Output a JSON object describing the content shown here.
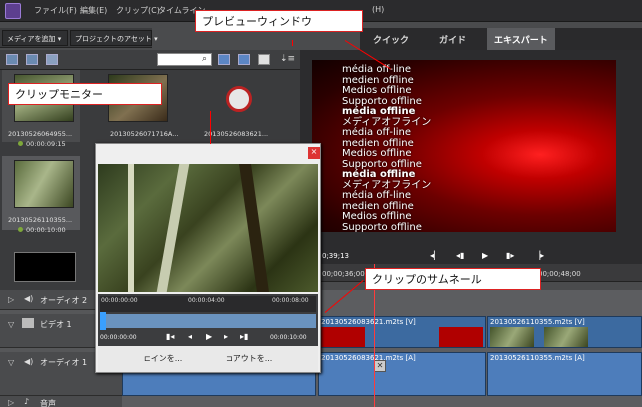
{
  "menubar": {
    "items": [
      "ファイル(F)",
      "編集(E)",
      "クリップ(C)",
      "タイムライン"
    ],
    "trailing": "(H)"
  },
  "toolbar": {
    "add_media_label": "メディアを追加",
    "project_assets_label": "プロジェクトのアセット"
  },
  "modes": {
    "quick": "クイック",
    "guided": "ガイド",
    "expert": "エキスパート"
  },
  "assets": {
    "clips": [
      {
        "name": "20130526064955...",
        "duration": "00:00:09:15"
      },
      {
        "name": "20130526071716A...",
        "duration": ""
      },
      {
        "name": "20130526083621...",
        "duration": ""
      },
      {
        "name": "20130526110355...",
        "duration": "00:00:10:00"
      }
    ]
  },
  "preview": {
    "lines": [
      "média off-line",
      "medien offline",
      "Medios offline",
      "Supporto offline",
      "média offline",
      "メディアオフライン",
      "média off-line",
      "medien offline",
      "Medios offline",
      "Supporto offline",
      "média offline",
      "メディアオフライン",
      "média off-line",
      "medien offline",
      "Medios offline",
      "Supporto offline"
    ],
    "bold_indices": [
      4,
      10
    ]
  },
  "timeline": {
    "current_time": "0;39;13",
    "ruler_left": "00;00;36;00",
    "ruler_right": "00;00;48;00",
    "tracks": {
      "audio2": "オーディオ 2",
      "video1": "ビデオ 1",
      "audio1": "オーディオ 1",
      "narration": "音声"
    },
    "clips": {
      "video_a": "20130526083621.m2ts [V]",
      "video_b": "20130526110355.m2ts [V]",
      "audio_a": "20130526083621.m2ts [A]",
      "audio_b": "20130526110355.m2ts [A]"
    }
  },
  "clip_monitor": {
    "close_label": "×",
    "tc_start": "00:00:00:00",
    "tc_mid": "00:00:04:00",
    "tc_end": "00:00:08:00",
    "tc_current": "00:00:00:00",
    "tc_duration": "00:00:10:00",
    "in_label": "インを...",
    "out_label": "アウトを..."
  },
  "callouts": {
    "preview_window": "プレビューウィンドウ",
    "clip_monitor": "クリップモニター",
    "clip_thumbnail": "クリップのサムネール"
  }
}
